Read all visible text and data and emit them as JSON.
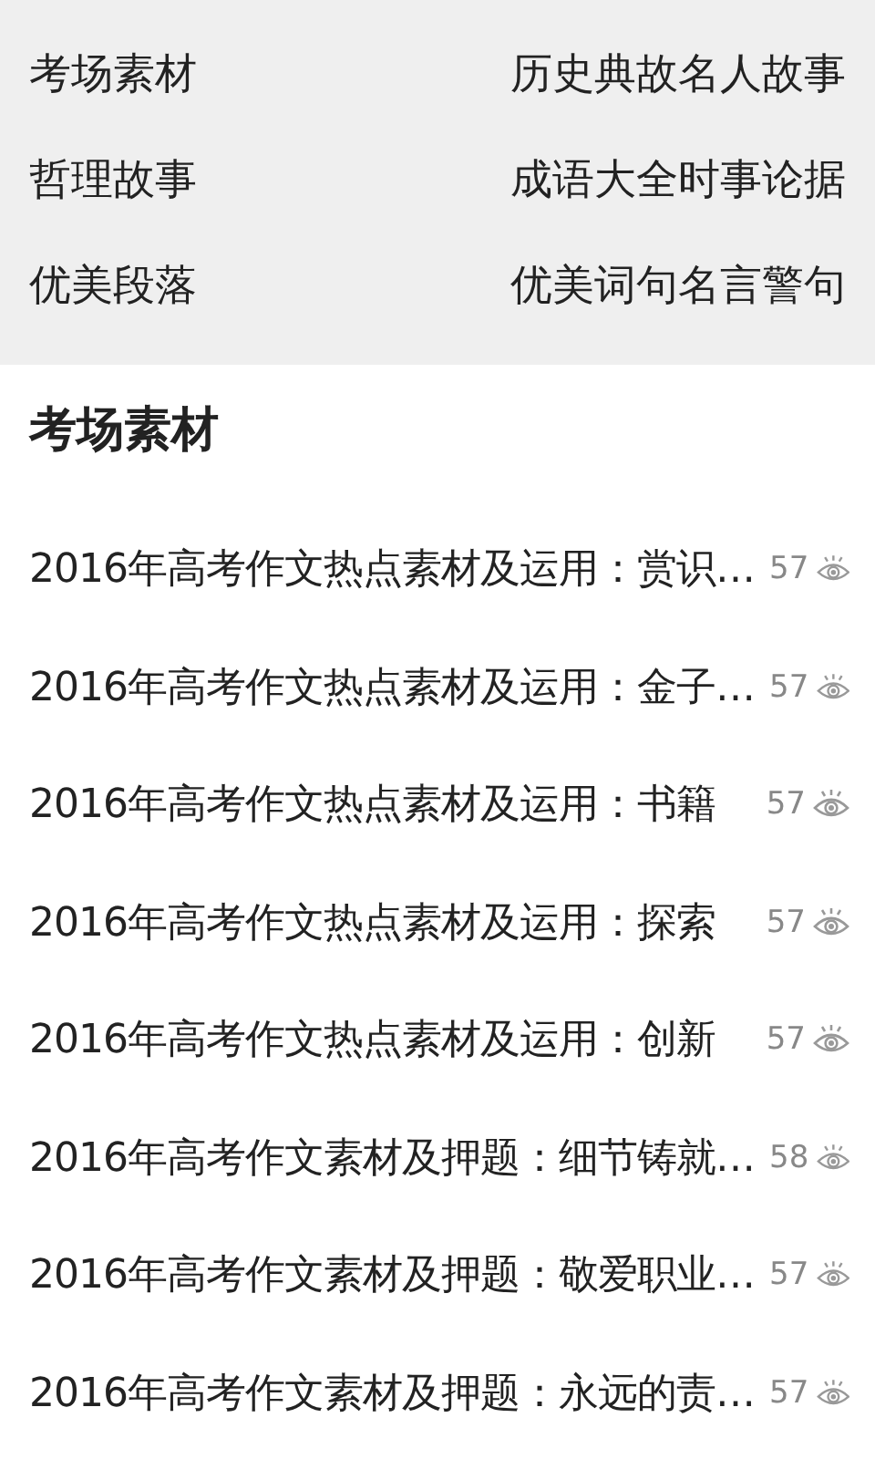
{
  "categories": [
    {
      "label": "考场素材"
    },
    {
      "label": "历史典故"
    },
    {
      "label": "名人故事"
    },
    {
      "label": "哲理故事"
    },
    {
      "label": "成语大全"
    },
    {
      "label": "时事论据"
    },
    {
      "label": "优美段落"
    },
    {
      "label": "优美词句"
    },
    {
      "label": "名言警句"
    }
  ],
  "section_title": "考场素材",
  "articles": [
    {
      "title": "2016年高考作文热点素材及运用：赏识…",
      "views": "57"
    },
    {
      "title": "2016年高考作文热点素材及运用：金子…",
      "views": "57"
    },
    {
      "title": "2016年高考作文热点素材及运用：书籍",
      "views": "57"
    },
    {
      "title": "2016年高考作文热点素材及运用：探索",
      "views": "57"
    },
    {
      "title": "2016年高考作文热点素材及运用：创新",
      "views": "57"
    },
    {
      "title": "2016年高考作文素材及押题：细节铸就…",
      "views": "58"
    },
    {
      "title": "2016年高考作文素材及押题：敬爱职业…",
      "views": "57"
    },
    {
      "title": "2016年高考作文素材及押题：永远的责…",
      "views": "57"
    }
  ]
}
